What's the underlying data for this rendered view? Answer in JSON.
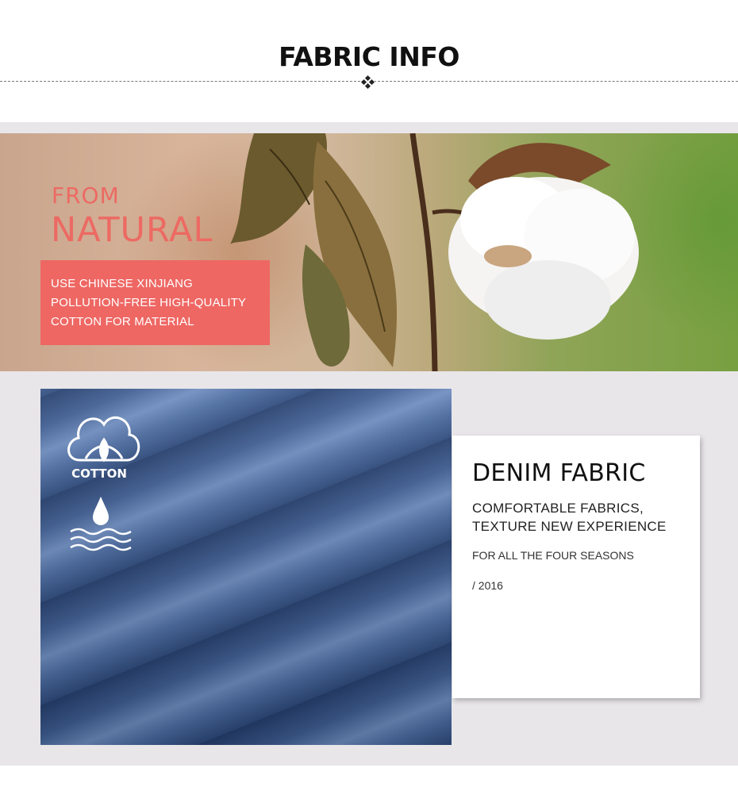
{
  "header": {
    "title": "FABRIC INFO"
  },
  "banner": {
    "from_label": "FROM",
    "natural_label": "NATURAL",
    "description_lines": [
      "USE CHINESE XINJIANG",
      "POLLUTION-FREE HIGH-QUALITY",
      "COTTON FOR MATERIAL"
    ]
  },
  "denim_panel": {
    "cotton_badge_label": "COTTON"
  },
  "card": {
    "title": "DENIM FABRIC",
    "subtitle_lines": [
      "COMFORTABLE FABRICS,",
      "TEXTURE NEW EXPERIENCE"
    ],
    "seasons": "FOR ALL THE FOUR SEASONS",
    "year": "/ 2016"
  },
  "colors": {
    "accent": "#ee6763",
    "background_grey": "#e8e6e9",
    "denim": "#3e5d92"
  },
  "icons": [
    "diamond-ornament-icon",
    "cotton-flower-icon",
    "water-drop-icon",
    "waves-icon"
  ]
}
